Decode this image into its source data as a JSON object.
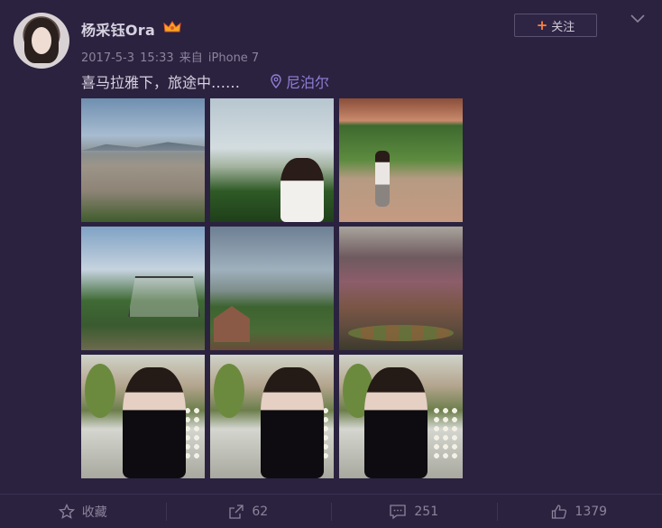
{
  "user": {
    "name": "杨采钰Ora",
    "badge_icon": "crown-icon"
  },
  "meta": {
    "date": "2017-5-3",
    "time": "15:33",
    "source_prefix": "来自",
    "source_device": "iPhone 7"
  },
  "follow": {
    "label": "关注",
    "plus": "+"
  },
  "post": {
    "text": "喜马拉雅下，旅途中……",
    "location": "尼泊尔"
  },
  "photos": [
    {
      "icon": "photo-city-view"
    },
    {
      "icon": "photo-woman-trees"
    },
    {
      "icon": "photo-woman-courtyard"
    },
    {
      "icon": "photo-pavilion"
    },
    {
      "icon": "photo-mountain-houses"
    },
    {
      "icon": "photo-market"
    },
    {
      "icon": "photo-portrait-1"
    },
    {
      "icon": "photo-portrait-2"
    },
    {
      "icon": "photo-portrait-3"
    }
  ],
  "actions": {
    "favorite": "收藏",
    "repost": "62",
    "comment": "251",
    "like": "1379"
  },
  "colors": {
    "background": "#2b2240",
    "location": "#8f7fd6",
    "follow_plus": "#ff8140",
    "crown": "#f6a623"
  }
}
